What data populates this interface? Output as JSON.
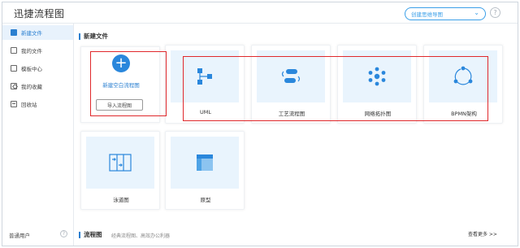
{
  "header": {
    "app_title": "迅捷流程图",
    "mode_select": "创建思维导图",
    "help_label": "?"
  },
  "sidebar": {
    "items": [
      {
        "label": "新建文件",
        "icon": "new-file-icon"
      },
      {
        "label": "我的文件",
        "icon": "file-icon"
      },
      {
        "label": "模板中心",
        "icon": "template-icon"
      },
      {
        "label": "我的收藏",
        "icon": "star-icon"
      },
      {
        "label": "回收站",
        "icon": "trash-icon"
      }
    ],
    "user_label": "普通用户",
    "user_help": "?"
  },
  "main": {
    "new_file_title": "新建文件",
    "new_blank": {
      "label": "新建空白流程图",
      "import_label": "导入流程图"
    },
    "templates": [
      {
        "label": "UML",
        "icon": "uml-icon"
      },
      {
        "label": "工艺流程图",
        "icon": "process-flow-icon"
      },
      {
        "label": "网络拓扑图",
        "icon": "network-topology-icon"
      },
      {
        "label": "BPMN架构",
        "icon": "bpmn-icon"
      },
      {
        "label": "泳道图",
        "icon": "swimlane-icon"
      },
      {
        "label": "原型",
        "icon": "prototype-icon"
      }
    ],
    "flowchart_section": {
      "title": "流程图",
      "subtitle": "经典流程图、高效办公利器",
      "see_more": "查看更多 >>"
    }
  },
  "colors": {
    "accent": "#2a87dc",
    "highlight_box": "#e0292c",
    "thumb_bg": "#e9f4fd"
  }
}
